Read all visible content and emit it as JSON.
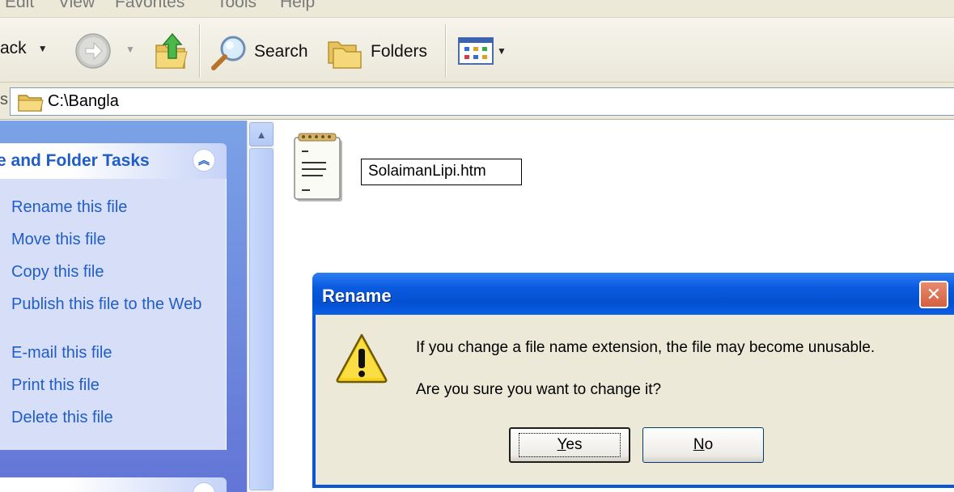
{
  "menu": {
    "items": [
      "Edit",
      "View",
      "Favorites",
      "Tools",
      "Help"
    ]
  },
  "toolbar": {
    "back_label": "ack",
    "search_label": "Search",
    "folders_label": "Folders"
  },
  "address": {
    "label": "s",
    "path": "C:\\Bangla"
  },
  "task_pane": {
    "title": "e and Folder Tasks",
    "links": [
      "Rename this file",
      "Move this file",
      "Copy this file",
      "Publish this file to the Web",
      "E-mail this file",
      "Print this file",
      "Delete this file"
    ]
  },
  "file": {
    "rename_value": "SolaimanLipi.htm",
    "icon": "notepad-document-icon"
  },
  "dialog": {
    "title": "Rename",
    "message": "If you change a file name extension, the file may become unusable.",
    "question": "Are you sure you want to change it?",
    "yes_mnemonic": "Y",
    "yes_rest": "es",
    "no_mnemonic": "N",
    "no_rest": "o",
    "close_glyph": "✕",
    "icon": "warning-icon"
  },
  "colors": {
    "xp_blue_title": "#0a56d8",
    "task_link": "#215dc6",
    "dialog_bg": "#ece9d8"
  }
}
